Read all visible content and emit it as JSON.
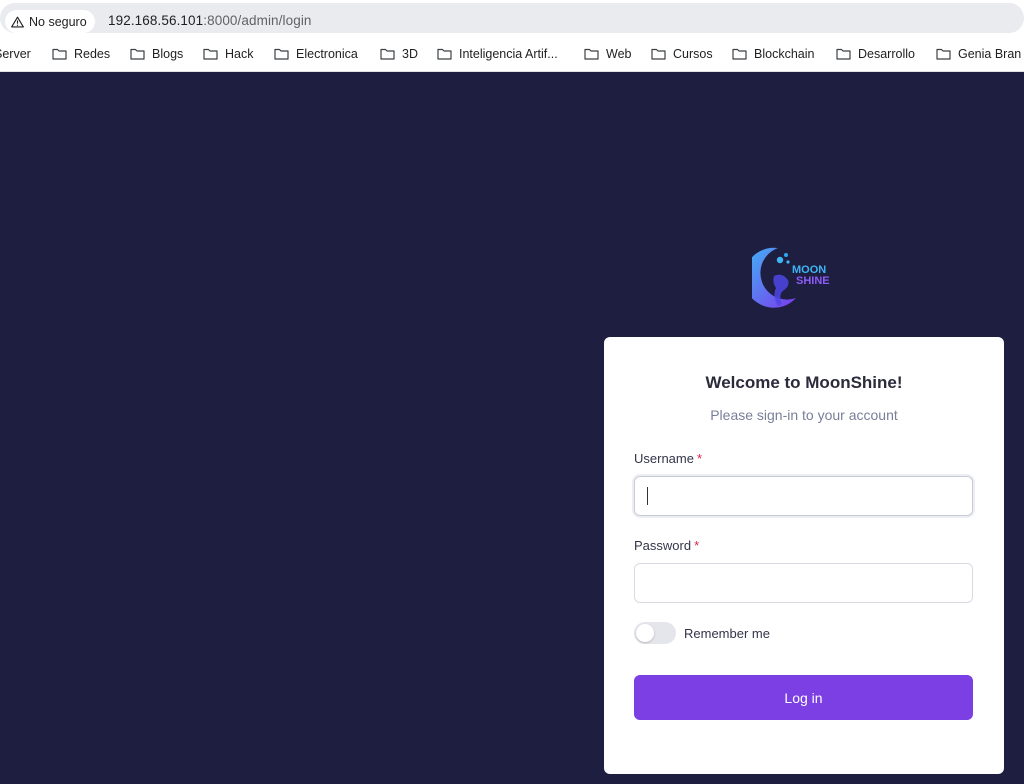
{
  "browser": {
    "security_label": "No seguro",
    "url_host": "192.168.56.101",
    "url_rest": ":8000/admin/login",
    "bookmarks": [
      "Server",
      "Redes",
      "Blogs",
      "Hack",
      "Electronica",
      "3D",
      "Inteligencia Artif...",
      "Web",
      "Cursos",
      "Blockchain",
      "Desarrollo",
      "Genia Bran"
    ]
  },
  "logo": {
    "line1": "MOON",
    "line2": "SHINE"
  },
  "login": {
    "title": "Welcome to MoonShine!",
    "subtitle": "Please sign-in to your account",
    "username_label": "Username",
    "password_label": "Password",
    "required_mark": "*",
    "username_value": "",
    "password_value": "",
    "remember_label": "Remember me",
    "remember_checked": false,
    "submit_label": "Log in"
  },
  "colors": {
    "page_background": "#1e1e40",
    "accent": "#7b3fe4",
    "required": "#e11d48"
  }
}
